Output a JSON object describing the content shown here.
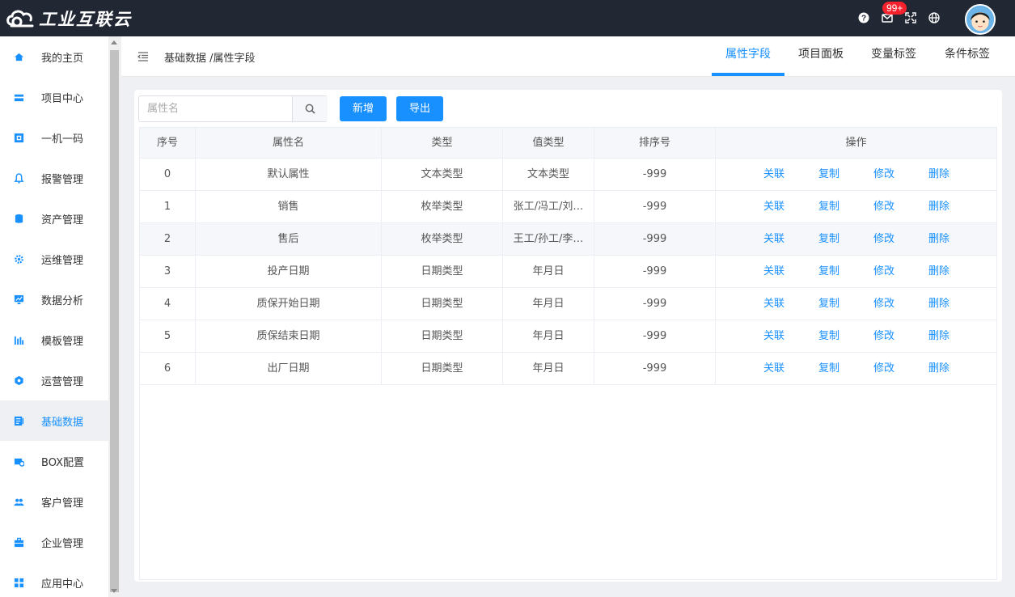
{
  "app": {
    "logo_text": "工业互联云",
    "badge_count": "99+"
  },
  "sidebar": {
    "items": [
      {
        "label": "我的主页",
        "icon": "home-icon"
      },
      {
        "label": "项目中心",
        "icon": "project-icon"
      },
      {
        "label": "一机一码",
        "icon": "qrcode-icon"
      },
      {
        "label": "报警管理",
        "icon": "bell-icon"
      },
      {
        "label": "资产管理",
        "icon": "asset-icon"
      },
      {
        "label": "运维管理",
        "icon": "gear-icon"
      },
      {
        "label": "数据分析",
        "icon": "chart-icon"
      },
      {
        "label": "模板管理",
        "icon": "template-icon"
      },
      {
        "label": "运营管理",
        "icon": "operation-icon"
      },
      {
        "label": "基础数据",
        "icon": "data-icon",
        "active": true
      },
      {
        "label": "BOX配置",
        "icon": "box-icon"
      },
      {
        "label": "客户管理",
        "icon": "users-icon"
      },
      {
        "label": "企业管理",
        "icon": "briefcase-icon"
      },
      {
        "label": "应用中心",
        "icon": "apps-icon"
      }
    ]
  },
  "header": {
    "breadcrumb": "基础数据 /属性字段",
    "tabs": [
      {
        "label": "属性字段",
        "active": true
      },
      {
        "label": "项目面板"
      },
      {
        "label": "变量标签"
      },
      {
        "label": "条件标签"
      }
    ]
  },
  "toolbar": {
    "search_placeholder": "属性名",
    "add_label": "新增",
    "export_label": "导出"
  },
  "table": {
    "columns": [
      "序号",
      "属性名",
      "类型",
      "值类型",
      "排序号",
      "操作"
    ],
    "actions": [
      "关联",
      "复制",
      "修改",
      "删除"
    ],
    "rows": [
      {
        "index": "0",
        "name": "默认属性",
        "type": "文本类型",
        "value_type": "文本类型",
        "sort": "-999"
      },
      {
        "index": "1",
        "name": "销售",
        "type": "枚举类型",
        "value_type": "张工/冯工/刘…",
        "sort": "-999"
      },
      {
        "index": "2",
        "name": "售后",
        "type": "枚举类型",
        "value_type": "王工/孙工/李…",
        "sort": "-999"
      },
      {
        "index": "3",
        "name": "投产日期",
        "type": "日期类型",
        "value_type": "年月日",
        "sort": "-999"
      },
      {
        "index": "4",
        "name": "质保开始日期",
        "type": "日期类型",
        "value_type": "年月日",
        "sort": "-999"
      },
      {
        "index": "5",
        "name": "质保结束日期",
        "type": "日期类型",
        "value_type": "年月日",
        "sort": "-999"
      },
      {
        "index": "6",
        "name": "出厂日期",
        "type": "日期类型",
        "value_type": "年月日",
        "sort": "-999"
      }
    ]
  },
  "colors": {
    "accent": "#1890ff",
    "topbar": "#212733",
    "badge": "#f5222d"
  }
}
